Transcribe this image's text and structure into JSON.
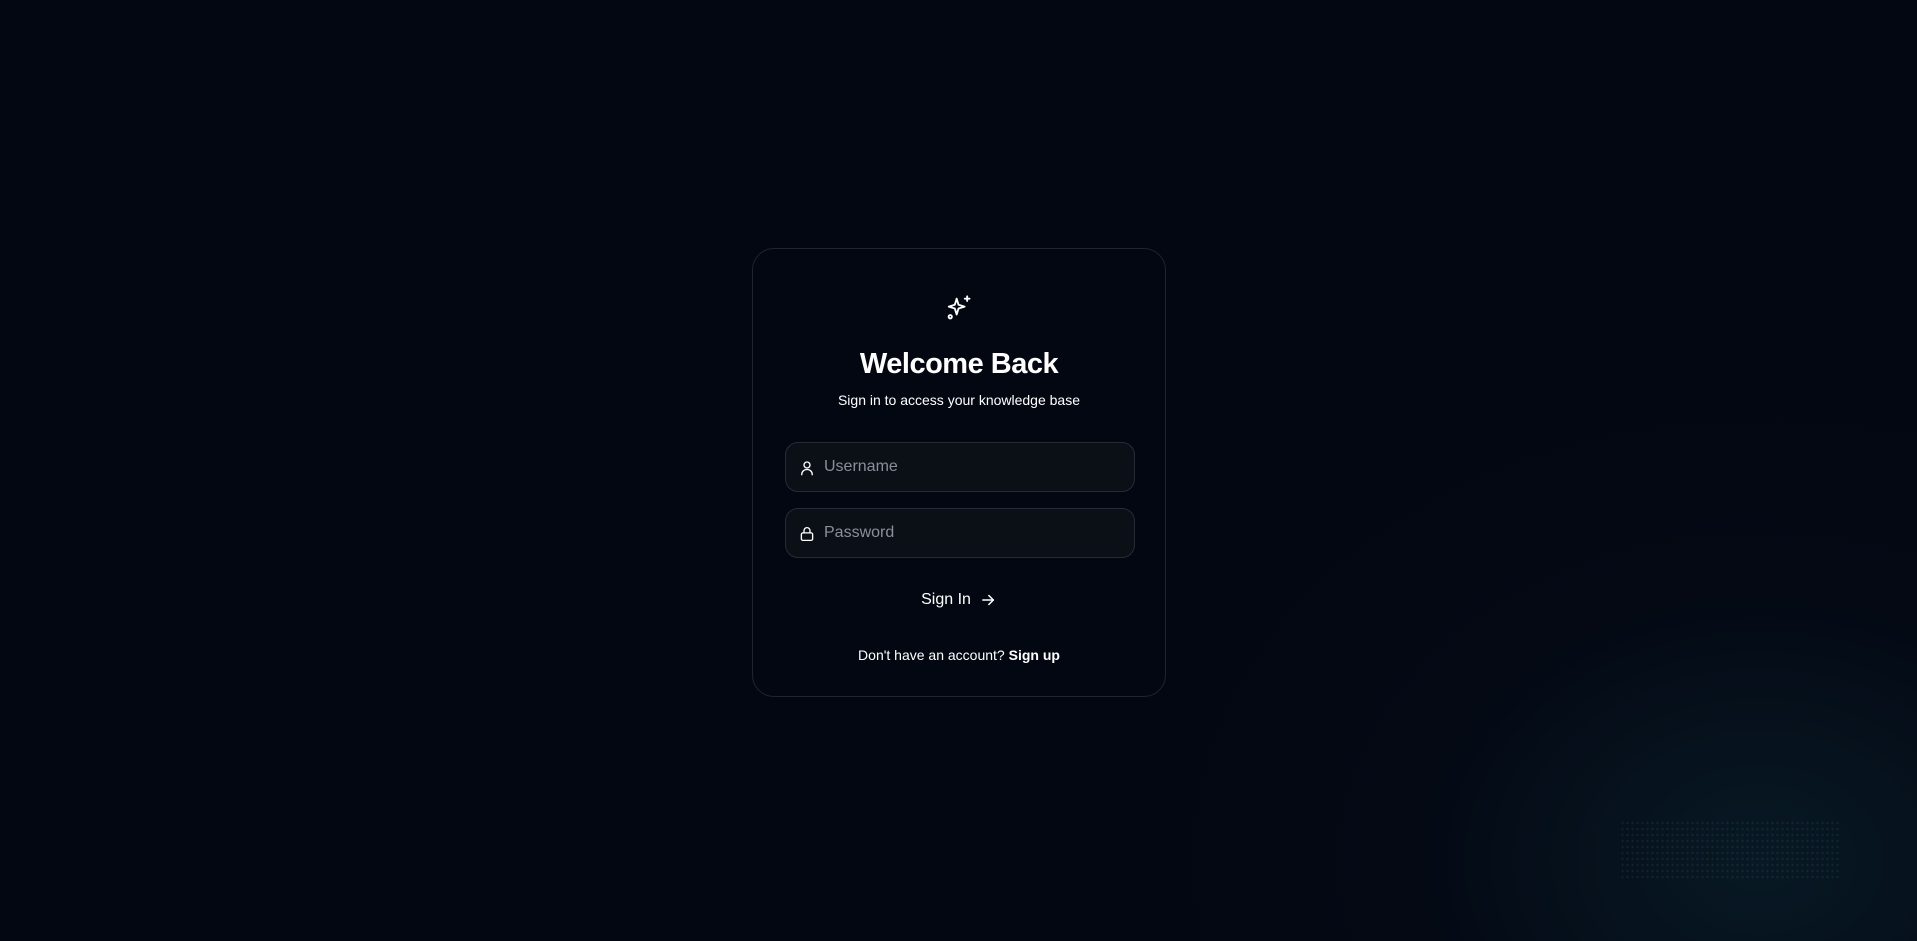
{
  "login": {
    "logo_icon": "sparkles-icon",
    "title": "Welcome Back",
    "subtitle": "Sign in to access your knowledge base",
    "username": {
      "icon": "user-icon",
      "value": "",
      "placeholder": "Username"
    },
    "password": {
      "icon": "lock-icon",
      "value": "",
      "placeholder": "Password"
    },
    "signin_label": "Sign In",
    "signin_icon": "arrow-right-icon",
    "footer_text": "Don't have an account?",
    "signup_label": "Sign up"
  },
  "colors": {
    "background": "#030712",
    "card_border": "#1f2430",
    "input_background": "#0b0f16",
    "input_border": "#262b36",
    "placeholder": "#8a8f99",
    "text": "#ffffff"
  }
}
